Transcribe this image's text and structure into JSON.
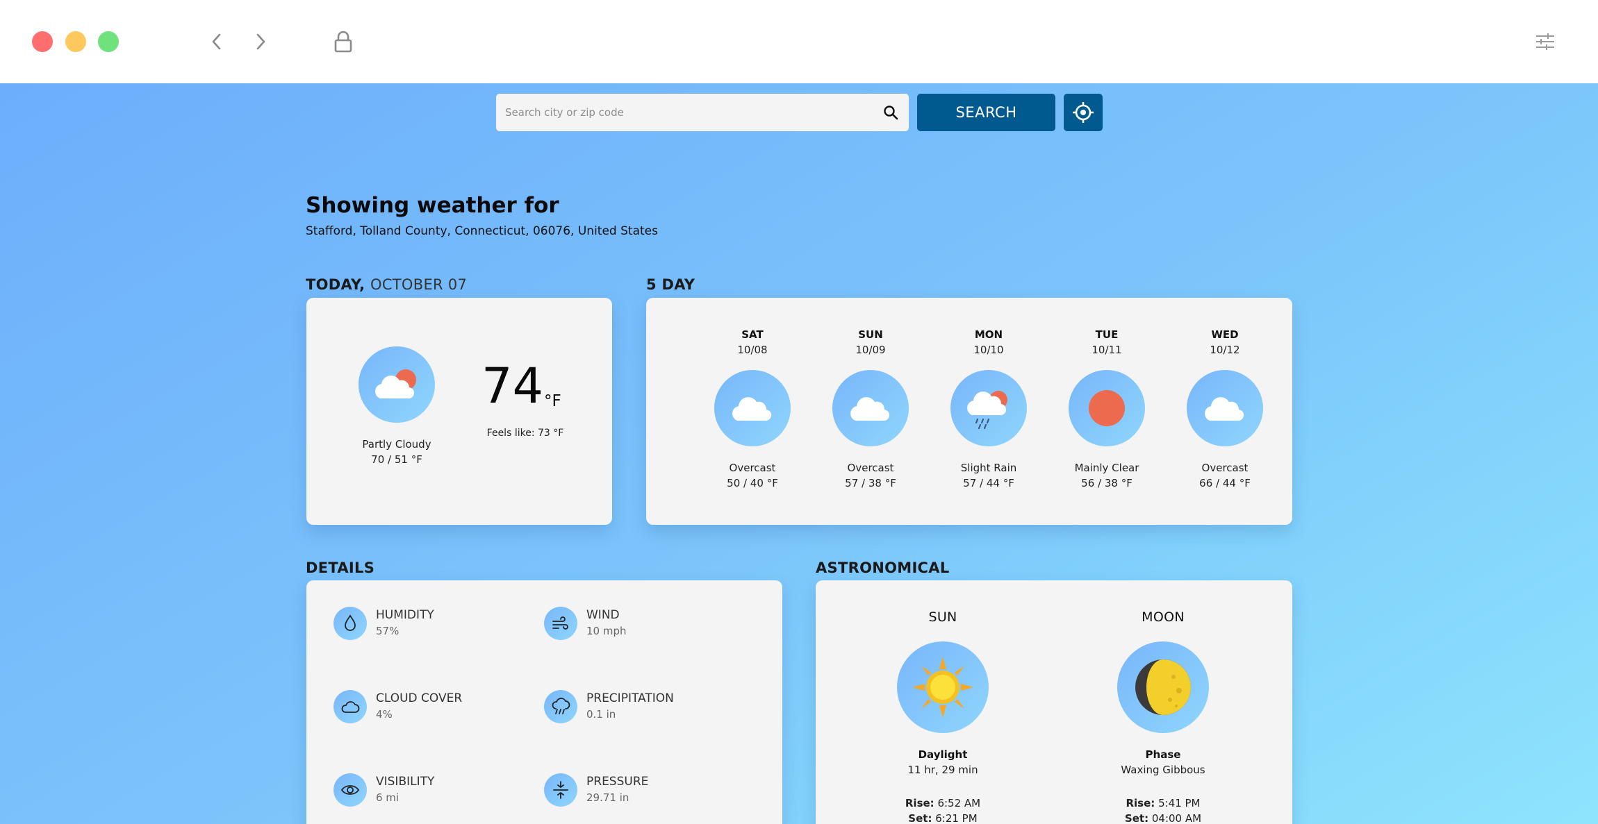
{
  "search": {
    "placeholder": "Search city or zip code",
    "button_label": "SEARCH"
  },
  "header": {
    "title": "Showing weather for",
    "location": "Stafford, Tolland County, Connecticut, 06076, United States"
  },
  "today": {
    "section_bold": "TODAY,",
    "section_date": "OCTOBER 07",
    "icon": "partly-cloudy-icon",
    "condition": "Partly Cloudy",
    "range": "70 / 51 °F",
    "temperature": "74",
    "unit": "°F",
    "feels_like": "Feels like: 73 °F"
  },
  "forecast": {
    "section_title": "5 DAY",
    "days": [
      {
        "day": "SAT",
        "date": "10/08",
        "icon": "overcast-icon",
        "condition": "Overcast",
        "range": "50 / 40 °F"
      },
      {
        "day": "SUN",
        "date": "10/09",
        "icon": "overcast-icon",
        "condition": "Overcast",
        "range": "57 / 38 °F"
      },
      {
        "day": "MON",
        "date": "10/10",
        "icon": "slight-rain-icon",
        "condition": "Slight Rain",
        "range": "57 / 44 °F"
      },
      {
        "day": "TUE",
        "date": "10/11",
        "icon": "mainly-clear-icon",
        "condition": "Mainly Clear",
        "range": "56 / 38 °F"
      },
      {
        "day": "WED",
        "date": "10/12",
        "icon": "overcast-icon",
        "condition": "Overcast",
        "range": "66 / 44 °F"
      }
    ]
  },
  "details": {
    "section_title": "DETAILS",
    "items": [
      {
        "label": "HUMIDITY",
        "value": "57%",
        "icon": "humidity-icon"
      },
      {
        "label": "WIND",
        "value": "10 mph",
        "icon": "wind-icon"
      },
      {
        "label": "CLOUD COVER",
        "value": "4%",
        "icon": "cloud-cover-icon"
      },
      {
        "label": "PRECIPITATION",
        "value": "0.1 in",
        "icon": "precipitation-icon"
      },
      {
        "label": "VISIBILITY",
        "value": "6 mi",
        "icon": "visibility-icon"
      },
      {
        "label": "PRESSURE",
        "value": "29.71 in",
        "icon": "pressure-icon"
      }
    ]
  },
  "astronomical": {
    "section_title": "ASTRONOMICAL",
    "sun": {
      "title": "SUN",
      "icon": "sun-icon",
      "stat_label": "Daylight",
      "stat_value": "11 hr, 29 min",
      "rise_label": "Rise:",
      "rise": "6:52 AM",
      "set_label": "Set:",
      "set": "6:21 PM"
    },
    "moon": {
      "title": "MOON",
      "icon": "moon-icon",
      "stat_label": "Phase",
      "stat_value": "Waxing Gibbous",
      "rise_label": "Rise:",
      "rise": "5:41 PM",
      "set_label": "Set:",
      "set": "04:00 AM"
    }
  },
  "colors": {
    "accent": "#005a8f",
    "sun_orange": "#ec6a4e",
    "background_start": "#6daefb",
    "background_end": "#8ee4fd",
    "card": "#f4f4f4"
  }
}
